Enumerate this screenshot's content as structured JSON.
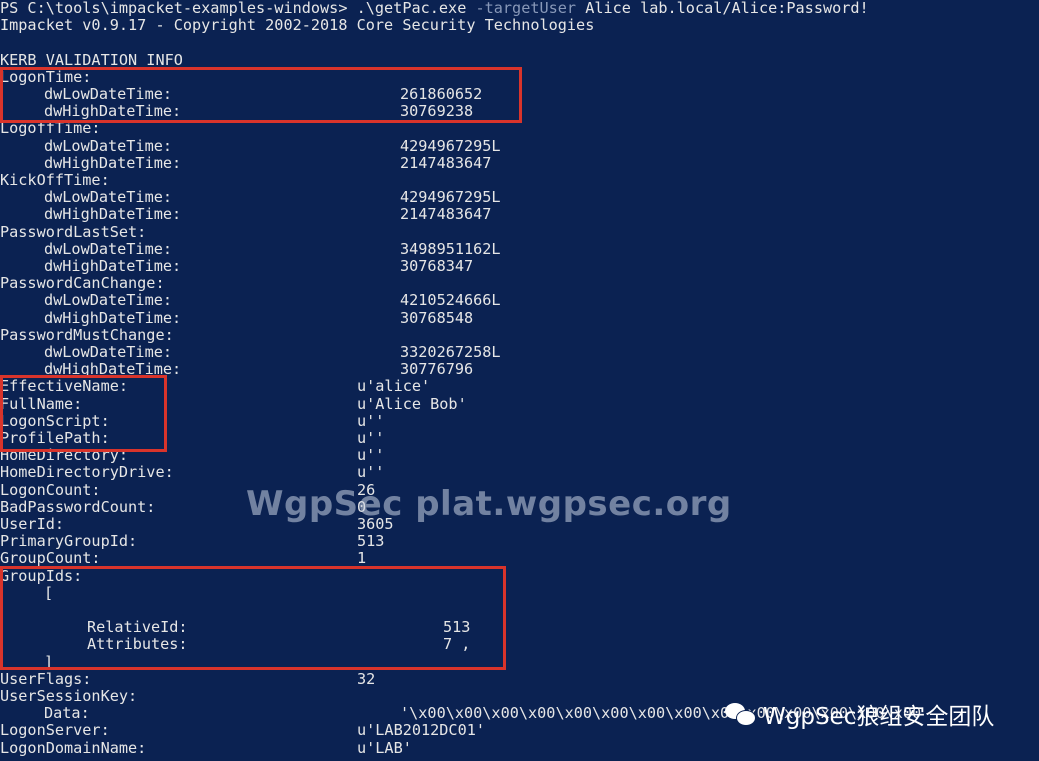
{
  "prompt": {
    "ps_path": "PS C:\\tools\\impacket-examples-windows> ",
    "exe": ".\\getPac.exe",
    "flag": " -targetUser",
    "args": " Alice lab.local/Alice:Password!"
  },
  "banner": "Impacket v0.9.17 - Copyright 2002-2018 Core Security Technologies",
  "section_title": "KERB_VALIDATION_INFO",
  "time_blocks": [
    {
      "name": "LogonTime:",
      "low_label": "dwLowDateTime:",
      "low": "261860652",
      "high_label": "dwHighDateTime:",
      "high": "30769238"
    },
    {
      "name": "LogoffTime:",
      "low_label": "dwLowDateTime:",
      "low": "4294967295L",
      "high_label": "dwHighDateTime:",
      "high": "2147483647"
    },
    {
      "name": "KickOffTime:",
      "low_label": "dwLowDateTime:",
      "low": "4294967295L",
      "high_label": "dwHighDateTime:",
      "high": "2147483647"
    },
    {
      "name": "PasswordLastSet:",
      "low_label": "dwLowDateTime:",
      "low": "3498951162L",
      "high_label": "dwHighDateTime:",
      "high": "30768347"
    },
    {
      "name": "PasswordCanChange:",
      "low_label": "dwLowDateTime:",
      "low": "4210524666L",
      "high_label": "dwHighDateTime:",
      "high": "30768548"
    },
    {
      "name": "PasswordMustChange:",
      "low_label": "dwLowDateTime:",
      "low": "3320267258L",
      "high_label": "dwHighDateTime:",
      "high": "30776796"
    }
  ],
  "fields": [
    {
      "key": "EffectiveName:",
      "value": "u'alice'"
    },
    {
      "key": "FullName:",
      "value": "u'Alice Bob'"
    },
    {
      "key": "LogonScript:",
      "value": "u''"
    },
    {
      "key": "ProfilePath:",
      "value": "u''"
    },
    {
      "key": "HomeDirectory:",
      "value": "u''"
    },
    {
      "key": "HomeDirectoryDrive:",
      "value": "u''"
    },
    {
      "key": "LogonCount:",
      "value": "26"
    },
    {
      "key": "BadPasswordCount:",
      "value": "0"
    },
    {
      "key": "UserId:",
      "value": "3605"
    },
    {
      "key": "PrimaryGroupId:",
      "value": "513"
    },
    {
      "key": "GroupCount:",
      "value": "1"
    }
  ],
  "group_ids": {
    "label": "GroupIds:",
    "open": "[",
    "relative_label": "RelativeId:",
    "relative_value": "513",
    "attributes_label": "Attributes:",
    "attributes_value": "7 ,",
    "close": "]"
  },
  "tail": [
    {
      "key": "UserFlags:",
      "value": "32"
    },
    {
      "key": "UserSessionKey:",
      "value": ""
    }
  ],
  "session_data": {
    "label": "Data:",
    "value": "'\\x00\\x00\\x00\\x00\\x00\\x00\\x00\\x00\\x00\\x00\\x00\\x00\\x00\\x00"
  },
  "tail2": [
    {
      "key": "LogonServer:",
      "value": "u'LAB2012DC01'"
    },
    {
      "key": "LogonDomainName:",
      "value": "u'LAB'"
    }
  ],
  "watermarks": {
    "center": "WgpSec plat.wgpsec.org",
    "corner": "WgpSec狼组安全团队",
    "corner_icon": "wechat-icon"
  },
  "colors": {
    "background": "#0b2252",
    "highlight_box": "#d9342b",
    "text": "#e6e6e6",
    "dim_flag": "#8898b8"
  }
}
